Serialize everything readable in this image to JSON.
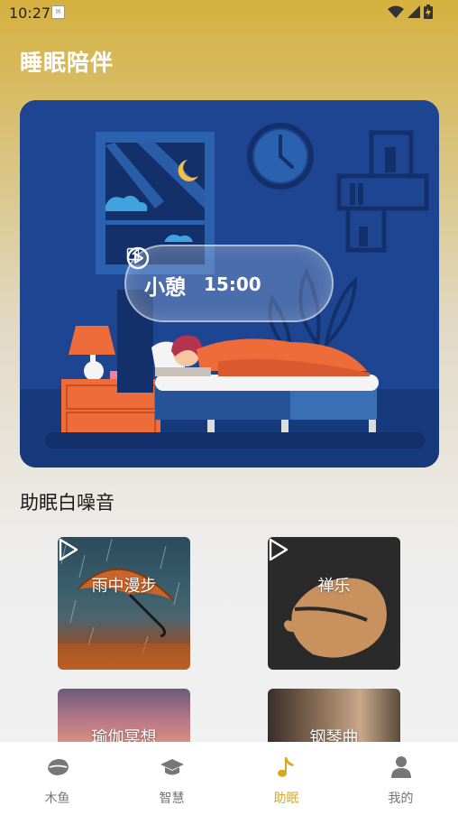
{
  "status_bar": {
    "time": "10:27",
    "notification_icon": "notification-icon",
    "icons": [
      "wifi-icon",
      "signal-icon",
      "battery-icon"
    ]
  },
  "header": {
    "title": "睡眠陪伴"
  },
  "hero": {
    "timer_label": "小憩",
    "timer_value": "15:00",
    "edit_icon": "edit-icon",
    "play_icon": "play-circle-icon"
  },
  "section": {
    "title": "助眠白噪音"
  },
  "tiles": [
    {
      "label": "雨中漫步",
      "icon": "play-icon"
    },
    {
      "label": "禅乐",
      "icon": "play-icon"
    },
    {
      "label": "瑜伽冥想",
      "icon": "play-icon"
    },
    {
      "label": "钢琴曲",
      "icon": "play-icon"
    }
  ],
  "nav": {
    "items": [
      {
        "label": "木鱼",
        "icon": "woodfish-icon"
      },
      {
        "label": "智慧",
        "icon": "graduation-cap-icon"
      },
      {
        "label": "助眠",
        "icon": "music-note-icon",
        "active": true
      },
      {
        "label": "我的",
        "icon": "person-icon"
      }
    ]
  },
  "colors": {
    "accent": "#d8a91c",
    "hero_bg": "#1d4591"
  }
}
